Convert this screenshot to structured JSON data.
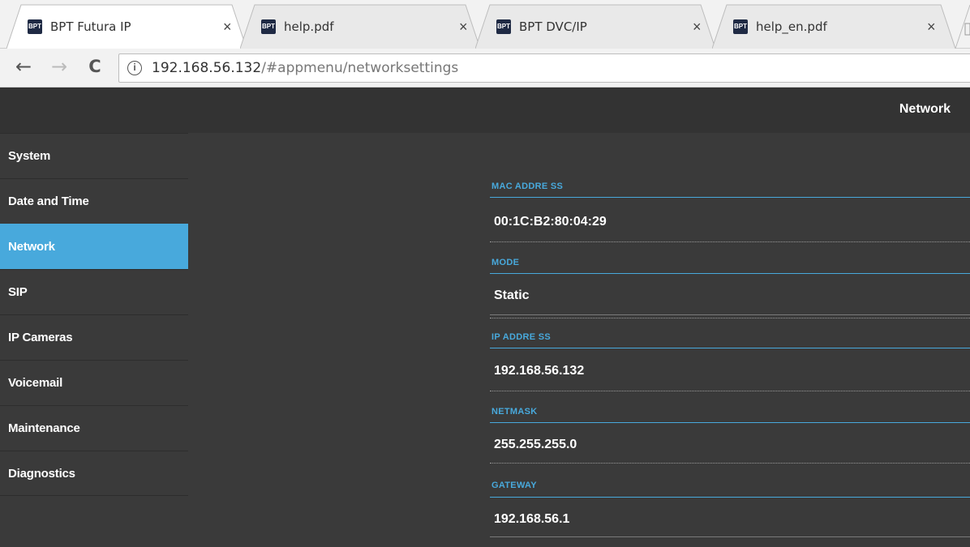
{
  "browser": {
    "tabs": [
      {
        "title": "BPT Futura IP",
        "favicon": "BPT",
        "active": true
      },
      {
        "title": "help.pdf",
        "favicon": "BPT",
        "active": false
      },
      {
        "title": "BPT DVC/IP",
        "favicon": "BPT",
        "active": false
      },
      {
        "title": "help_en.pdf",
        "favicon": "BPT",
        "active": false
      }
    ],
    "close_glyph": "×",
    "back_glyph": "←",
    "forward_glyph": "→",
    "reload_glyph": "C",
    "info_glyph": "i",
    "url_host": "192.168.56.132",
    "url_path": "/#appmenu/networksettings"
  },
  "app": {
    "title": "Network",
    "sidebar": {
      "items": [
        {
          "label": "System",
          "active": false
        },
        {
          "label": "Date and Time",
          "active": false
        },
        {
          "label": "Network",
          "active": true
        },
        {
          "label": "SIP",
          "active": false
        },
        {
          "label": "IP Cameras",
          "active": false
        },
        {
          "label": "Voicemail",
          "active": false
        },
        {
          "label": "Maintenance",
          "active": false
        },
        {
          "label": "Diagnostics",
          "active": false
        }
      ]
    },
    "fields": [
      {
        "label": "MAC ADDRE SS",
        "value": "00:1C:B2:80:04:29"
      },
      {
        "label": "MODE",
        "value": "Static"
      },
      {
        "label": "IP ADDRE SS",
        "value": "192.168.56.132"
      },
      {
        "label": "NETMASK",
        "value": "255.255.255.0"
      },
      {
        "label": "GATEWAY",
        "value": "192.168.56.1"
      }
    ]
  },
  "colors": {
    "accent": "#48a9dc",
    "background": "#3a3a3a",
    "header": "#333333",
    "chrome": "#f2f2f2"
  }
}
